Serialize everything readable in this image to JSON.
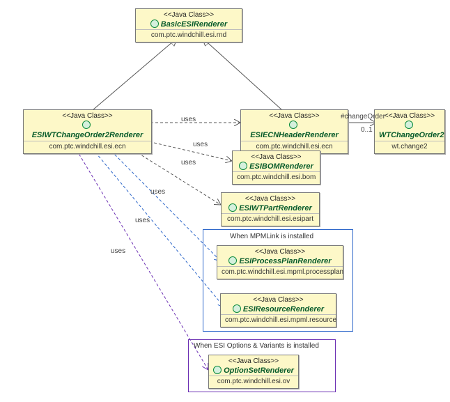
{
  "classes": {
    "basic": {
      "stereo": "<<Java Class>>",
      "name": "BasicESIRenderer",
      "pkg": "com.ptc.windchill.esi.rnd"
    },
    "esiwt": {
      "stereo": "<<Java Class>>",
      "name": "ESIWTChangeOrder2Renderer",
      "pkg": "com.ptc.windchill.esi.ecn"
    },
    "header": {
      "stereo": "<<Java Class>>",
      "name": "ESIECNHeaderRenderer",
      "pkg": "com.ptc.windchill.esi.ecn"
    },
    "wtco2": {
      "stereo": "<<Java Class>>",
      "name": "WTChangeOrder2",
      "pkg": "wt.change2"
    },
    "bom": {
      "stereo": "<<Java Class>>",
      "name": "ESIBOMRenderer",
      "pkg": "com.ptc.windchill.esi.bom"
    },
    "part": {
      "stereo": "<<Java Class>>",
      "name": "ESIWTPartRenderer",
      "pkg": "com.ptc.windchill.esi.esipart"
    },
    "process": {
      "stereo": "<<Java Class>>",
      "name": "ESIProcessPlanRenderer",
      "pkg": "com.ptc.windchill.esi.mpml.processplan"
    },
    "resource": {
      "stereo": "<<Java Class>>",
      "name": "ESIResourceRenderer",
      "pkg": "com.ptc.windchill.esi.mpml.resource"
    },
    "optset": {
      "stereo": "<<Java Class>>",
      "name": "OptionSetRenderer",
      "pkg": "com.ptc.windchill.esi.ov"
    }
  },
  "labels": {
    "uses": "uses",
    "changeOrder": "#changeOrder",
    "mult": "0..1"
  },
  "groups": {
    "mpm": "When MPMLink is installed",
    "ov": "When ESI Options & Variants is installed"
  }
}
